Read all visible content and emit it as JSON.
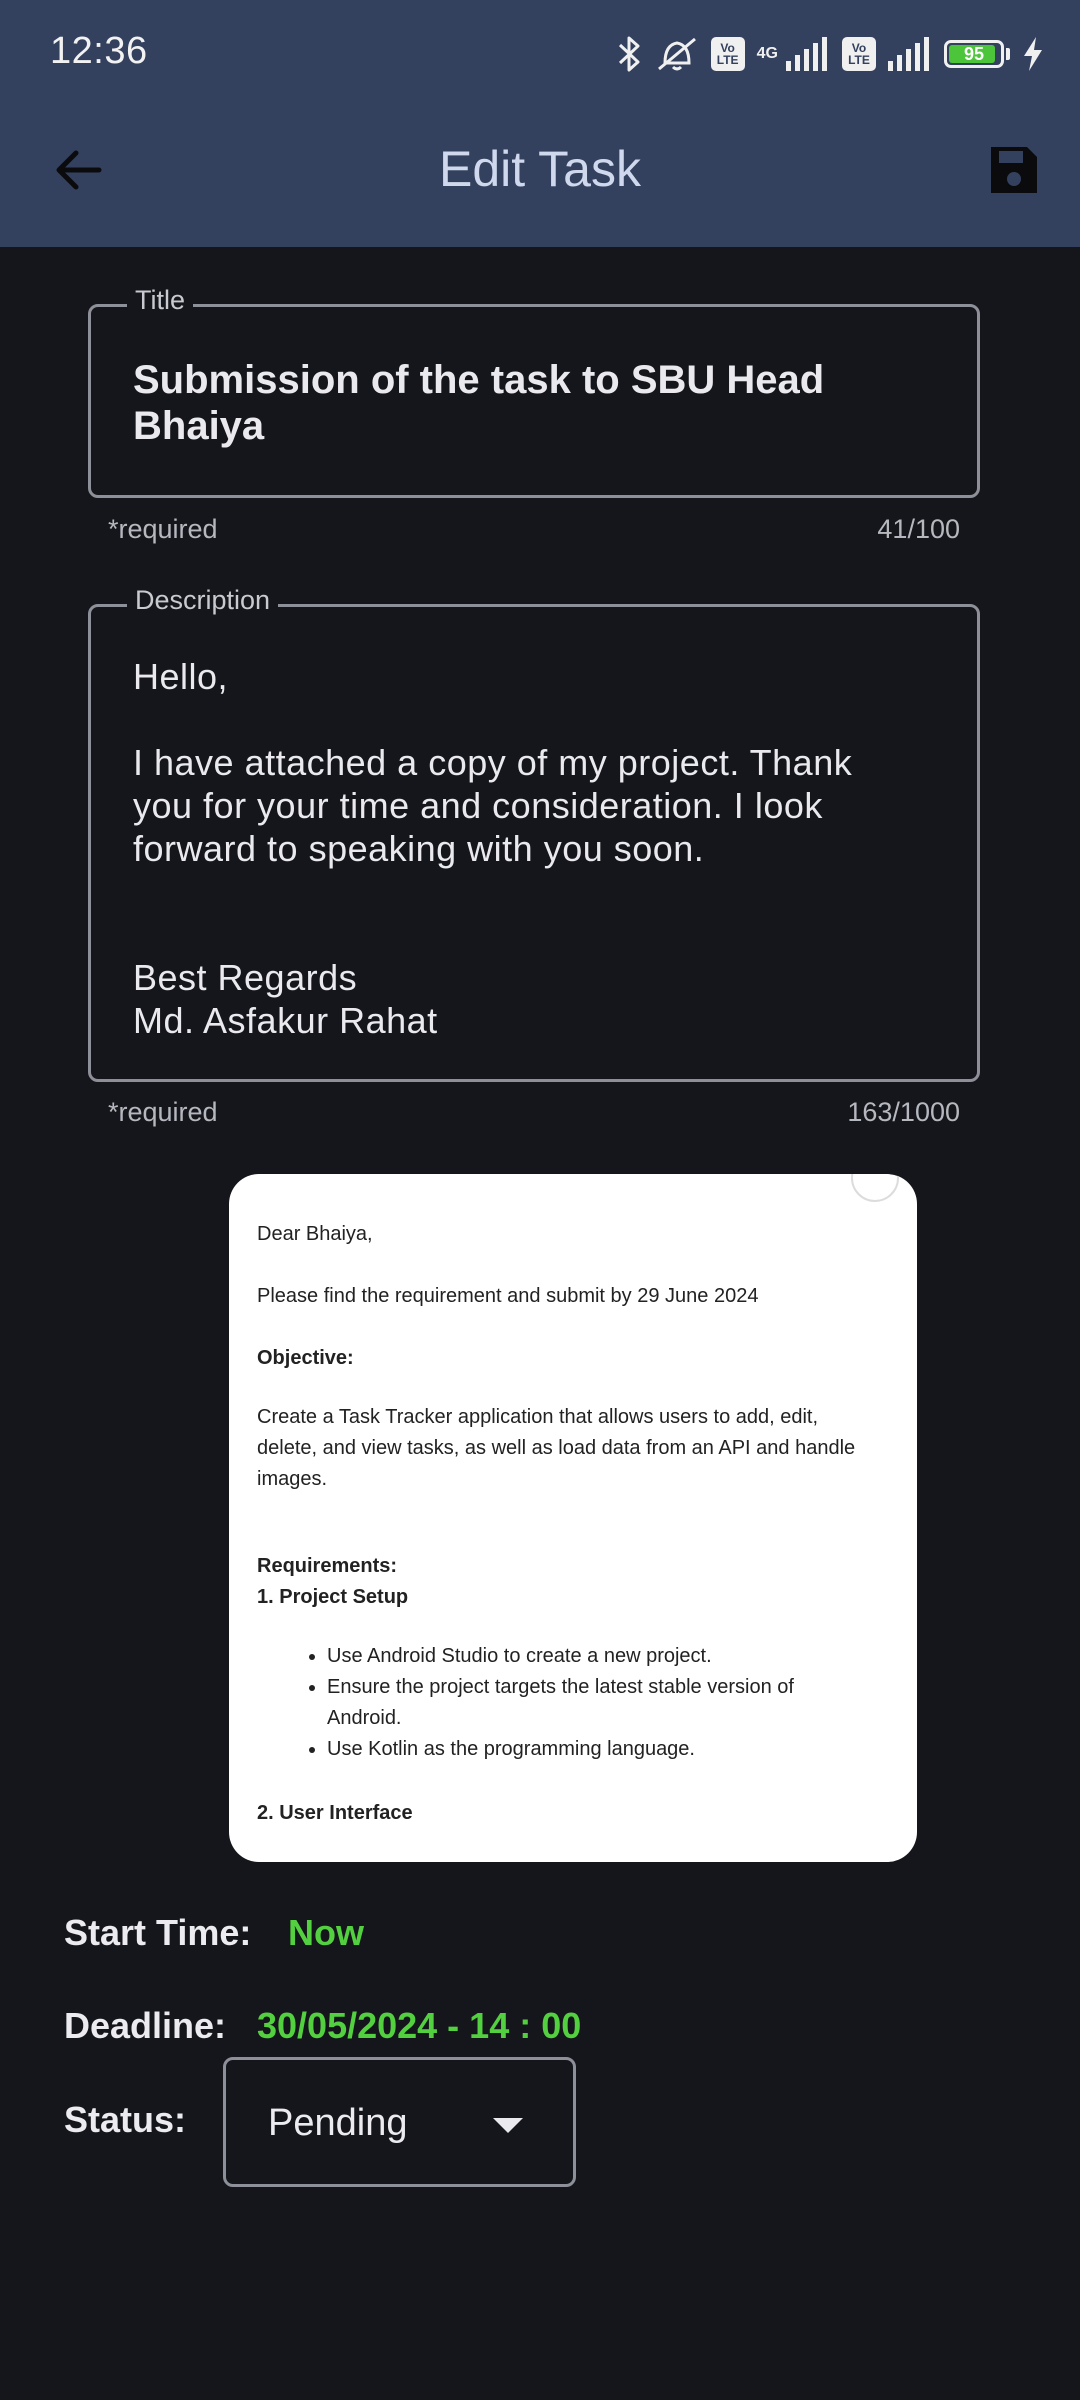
{
  "status_bar": {
    "time": "12:36",
    "battery_percent": "95",
    "network_label": "4G",
    "volte_top": "Vo",
    "volte_bottom": "LTE",
    "icons": [
      "bluetooth-icon",
      "vibrate-off-icon",
      "volte-icon",
      "signal-icon",
      "volte-icon",
      "signal-icon",
      "battery-icon",
      "charging-icon"
    ]
  },
  "app_bar": {
    "title": "Edit Task",
    "back_icon": "arrow-left-icon",
    "save_icon": "floppy-save-icon"
  },
  "title_field": {
    "label": "Title",
    "value": "Submission of the task to SBU Head\nBhaiya",
    "helper": "*required",
    "counter": "41/100"
  },
  "description_field": {
    "label": "Description",
    "value": "Hello,\n\nI have attached a copy of my project. Thank\nyou for your time and consideration. I look\nforward to speaking with you soon.\n\n\nBest Regards\nMd. Asfakur Rahat",
    "helper": "*required",
    "counter": "163/1000"
  },
  "attachment": {
    "greeting": "Dear Bhaiya,",
    "line1": "Please find the requirement and submit by 29 June 2024",
    "objective_heading": "Objective:",
    "objective_text": "Create a Task Tracker application that allows users to add, edit, delete, and view tasks, as well as load data from an API and handle images.",
    "requirements_heading": "Requirements:",
    "section1": "1. Project Setup",
    "bullets": [
      "Use Android Studio to create a new project.",
      "Ensure the project targets the latest stable version of Android.",
      "Use Kotlin as the programming language."
    ],
    "section2": "2. User Interface"
  },
  "start_time": {
    "label": "Start Time:",
    "value": "Now"
  },
  "deadline": {
    "label": "Deadline:",
    "value": "30/05/2024 - 14 : 00"
  },
  "status": {
    "label": "Status:",
    "selected": "Pending"
  },
  "colors": {
    "app_bar": "#33415e",
    "background": "#15161b",
    "accent_green": "#53d03f",
    "outline": "#8d9099"
  }
}
